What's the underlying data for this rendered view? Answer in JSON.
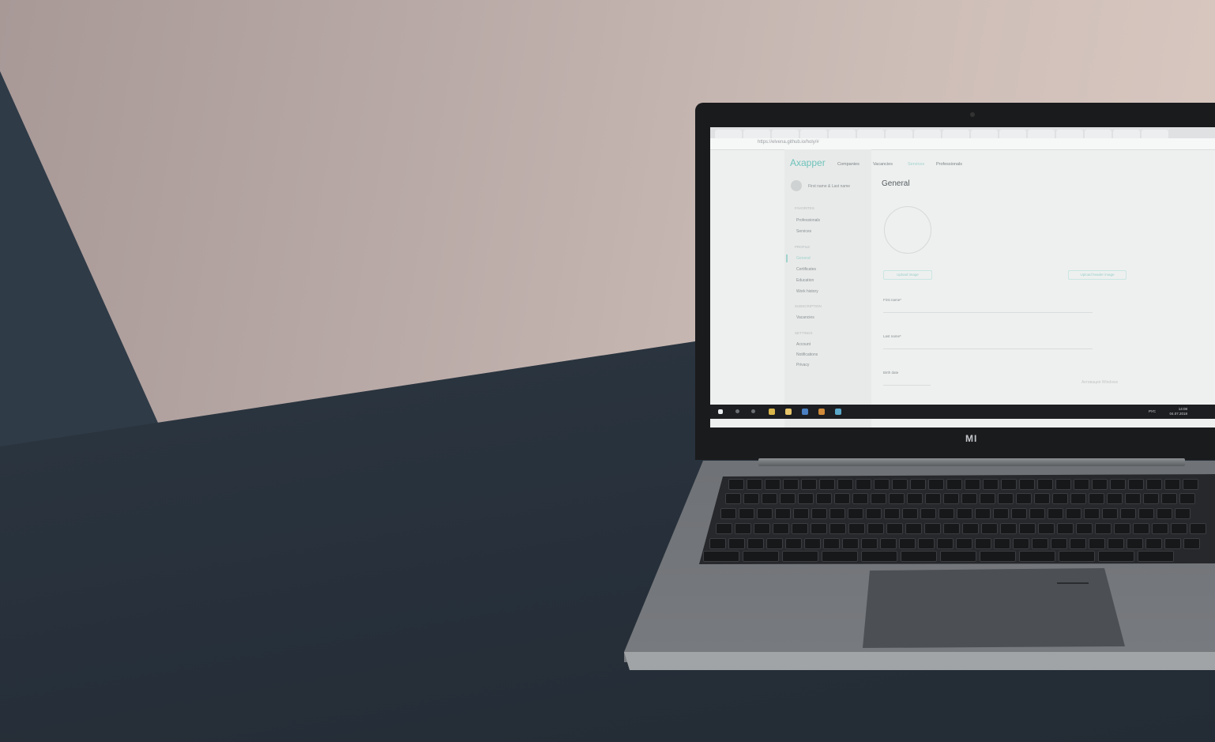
{
  "browser": {
    "url": "https://elvena.github.io/holy/#"
  },
  "app": {
    "brand": "Axapper",
    "nav": [
      "Companies",
      "Vacancies",
      "Services",
      "Professionals"
    ],
    "user_name": "First name & Last name",
    "page_title": "General",
    "sidebar": [
      {
        "section": "FAVORITES",
        "items": [
          "Professionals",
          "Services"
        ]
      },
      {
        "section": "PROFILE",
        "items": [
          "General",
          "Certificates",
          "Education",
          "Work history"
        ]
      },
      {
        "section": "SUBSCRIPTION",
        "items": [
          "Vacancies"
        ]
      },
      {
        "section": "SETTINGS",
        "items": [
          "Account",
          "Notifications",
          "Privacy"
        ]
      }
    ],
    "buttons": {
      "upload_image": "Upload image",
      "upload_header": "Upload header image"
    },
    "fields": {
      "first_name": "First name*",
      "last_name": "Last name*",
      "birth_date": "Birth date"
    }
  },
  "windows": {
    "watermark": "Активация Windows",
    "clock_time": "14:08",
    "clock_date": "04.07.2018",
    "language": "РУС"
  },
  "laptop": {
    "logo": "MI"
  }
}
